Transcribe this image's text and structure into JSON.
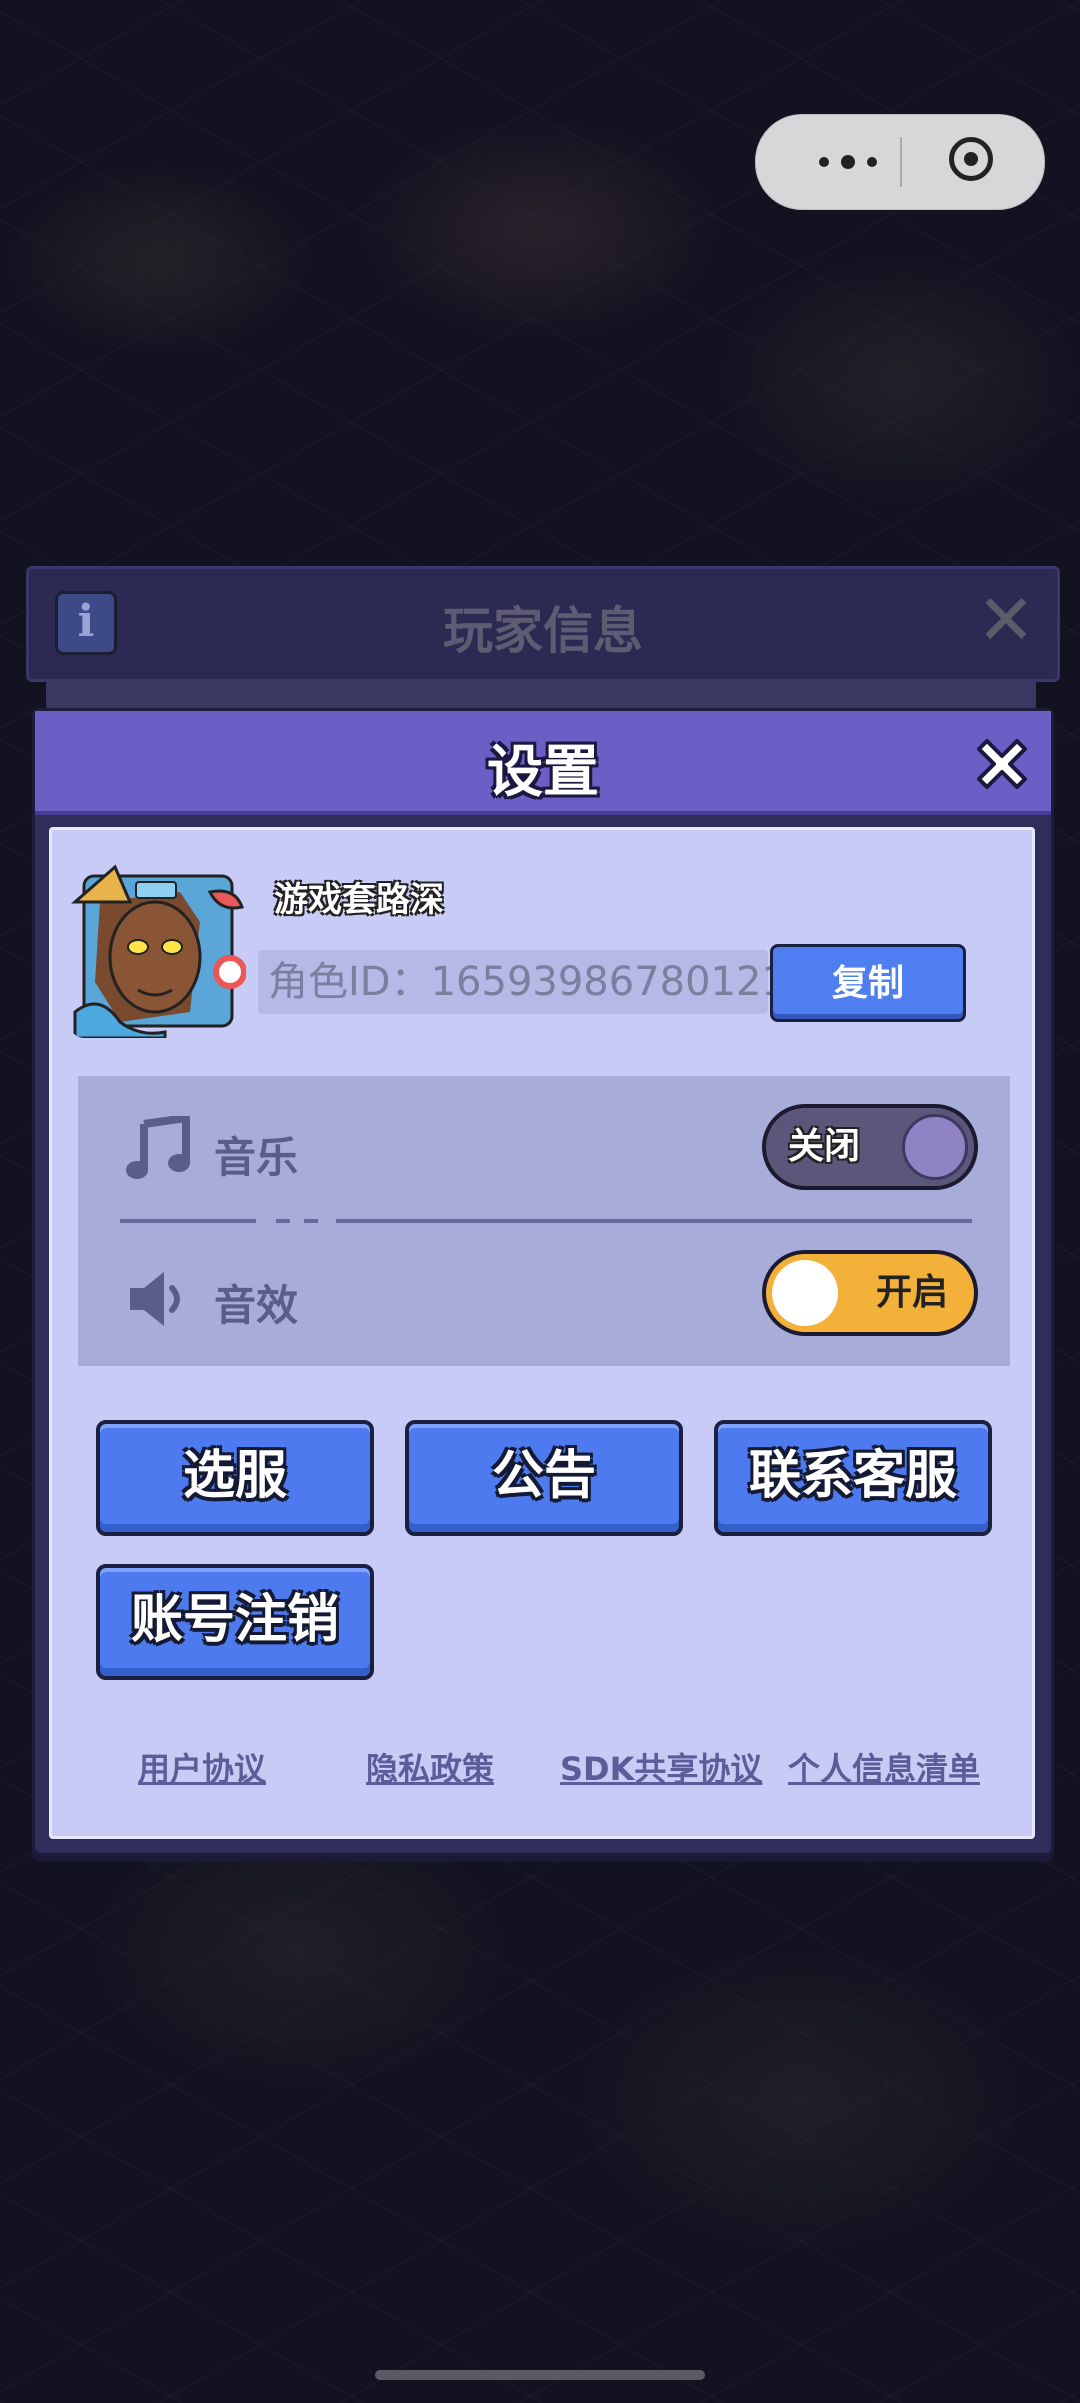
{
  "capsule": {
    "more_icon": "more-dots-icon",
    "close_icon": "target-close-icon"
  },
  "player_info": {
    "title": "玩家信息",
    "info_icon": "i",
    "close_icon": "close-icon"
  },
  "settings": {
    "title": "设置",
    "nickname": "游戏套路深",
    "role_id": "角色ID：16593986780121",
    "copy_label": "复制",
    "music": {
      "label": "音乐",
      "state": "关闭",
      "on": false
    },
    "sfx": {
      "label": "音效",
      "state": "开启",
      "on": true
    },
    "buttons": {
      "server": "选服",
      "notice": "公告",
      "support": "联系客服",
      "delete_account": "账号注销"
    },
    "links": {
      "user_agreement": "用户协议",
      "privacy": "隐私政策",
      "sdk": "SDK共享协议",
      "personal_info": "个人信息清单"
    },
    "colors": {
      "header": "#6b5fc6",
      "panel": "#c8cbf6",
      "button": "#4d7bef",
      "toggle_on": "#f4b13a",
      "toggle_off": "#5b577a"
    }
  }
}
